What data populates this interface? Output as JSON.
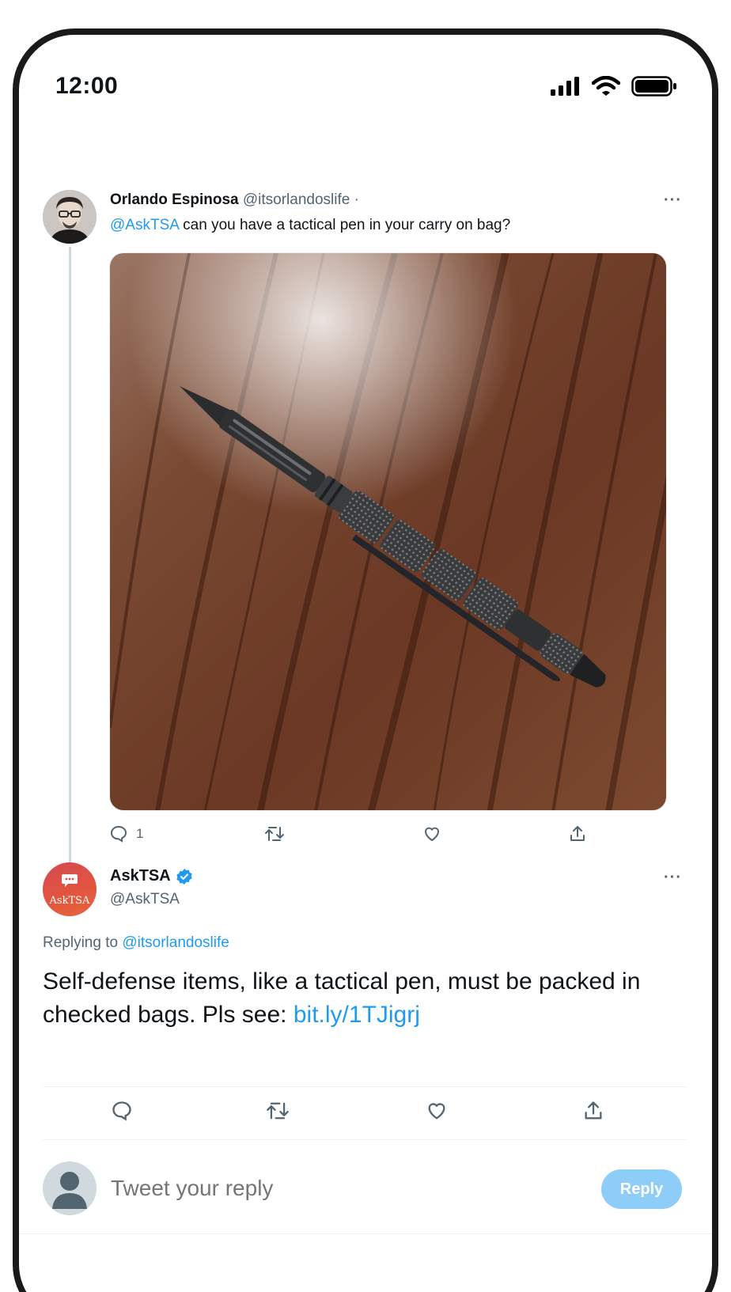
{
  "status_bar": {
    "time": "12:00"
  },
  "tweet1": {
    "author_name": "Orlando Espinosa",
    "author_handle": "@itsorlandoslife ·",
    "mention": "@AskTSA",
    "text": " can you have a tactical pen in your carry on bag?",
    "reply_count": "1"
  },
  "tweet2": {
    "author_name": "AskTSA",
    "author_handle": "@AskTSA",
    "avatar_label": "AskTSA",
    "replying_prefix": "Replying to ",
    "replying_handle": "@itsorlandoslife",
    "body_text": "Self-defense items, like a tactical pen, must be packed in checked bags. Pls see: ",
    "link": "bit.ly/1TJigrj"
  },
  "reply_bar": {
    "placeholder": "Tweet your reply",
    "button_label": "Reply"
  },
  "colors": {
    "accent": "#1d9bf0",
    "muted": "#536471",
    "reply_button": "#8ecdf8"
  }
}
